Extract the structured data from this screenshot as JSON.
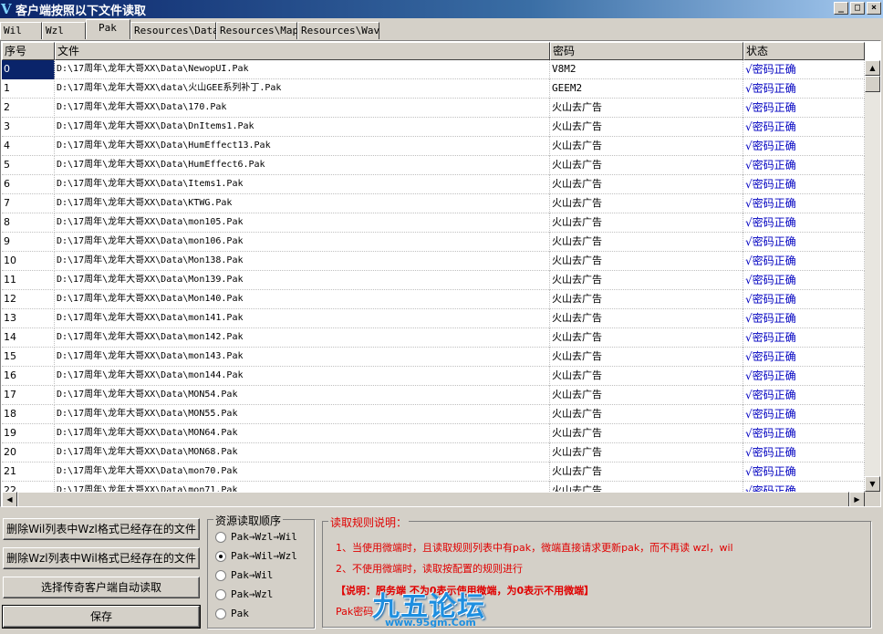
{
  "window": {
    "title": "客户端按照以下文件读取",
    "min_label": "_",
    "max_label": "□",
    "close_label": "×"
  },
  "tabs": [
    {
      "label": "Wil"
    },
    {
      "label": "Wzl"
    },
    {
      "label": "Pak"
    },
    {
      "label": "Resources\\Data"
    },
    {
      "label": "Resources\\Map"
    },
    {
      "label": "Resources\\Wav"
    }
  ],
  "table": {
    "columns": [
      "序号",
      "文件",
      "密码",
      "状态"
    ],
    "rows": [
      {
        "idx": "0",
        "file": "D:\\17周年\\龙年大哥XX\\Data\\NewopUI.Pak",
        "pwd": "V8M2",
        "status": "√密码正确"
      },
      {
        "idx": "1",
        "file": "D:\\17周年\\龙年大哥XX\\data\\火山GEE系列补丁.Pak",
        "pwd": "GEEM2",
        "status": "√密码正确"
      },
      {
        "idx": "2",
        "file": "D:\\17周年\\龙年大哥XX\\Data\\170.Pak",
        "pwd": "火山去广告",
        "status": "√密码正确"
      },
      {
        "idx": "3",
        "file": "D:\\17周年\\龙年大哥XX\\Data\\DnItems1.Pak",
        "pwd": "火山去广告",
        "status": "√密码正确"
      },
      {
        "idx": "4",
        "file": "D:\\17周年\\龙年大哥XX\\Data\\HumEffect13.Pak",
        "pwd": "火山去广告",
        "status": "√密码正确"
      },
      {
        "idx": "5",
        "file": "D:\\17周年\\龙年大哥XX\\Data\\HumEffect6.Pak",
        "pwd": "火山去广告",
        "status": "√密码正确"
      },
      {
        "idx": "6",
        "file": "D:\\17周年\\龙年大哥XX\\Data\\Items1.Pak",
        "pwd": "火山去广告",
        "status": "√密码正确"
      },
      {
        "idx": "7",
        "file": "D:\\17周年\\龙年大哥XX\\Data\\KTWG.Pak",
        "pwd": "火山去广告",
        "status": "√密码正确"
      },
      {
        "idx": "8",
        "file": "D:\\17周年\\龙年大哥XX\\Data\\mon105.Pak",
        "pwd": "火山去广告",
        "status": "√密码正确"
      },
      {
        "idx": "9",
        "file": "D:\\17周年\\龙年大哥XX\\Data\\mon106.Pak",
        "pwd": "火山去广告",
        "status": "√密码正确"
      },
      {
        "idx": "10",
        "file": "D:\\17周年\\龙年大哥XX\\Data\\Mon138.Pak",
        "pwd": "火山去广告",
        "status": "√密码正确"
      },
      {
        "idx": "11",
        "file": "D:\\17周年\\龙年大哥XX\\Data\\Mon139.Pak",
        "pwd": "火山去广告",
        "status": "√密码正确"
      },
      {
        "idx": "12",
        "file": "D:\\17周年\\龙年大哥XX\\Data\\Mon140.Pak",
        "pwd": "火山去广告",
        "status": "√密码正确"
      },
      {
        "idx": "13",
        "file": "D:\\17周年\\龙年大哥XX\\Data\\mon141.Pak",
        "pwd": "火山去广告",
        "status": "√密码正确"
      },
      {
        "idx": "14",
        "file": "D:\\17周年\\龙年大哥XX\\Data\\mon142.Pak",
        "pwd": "火山去广告",
        "status": "√密码正确"
      },
      {
        "idx": "15",
        "file": "D:\\17周年\\龙年大哥XX\\Data\\mon143.Pak",
        "pwd": "火山去广告",
        "status": "√密码正确"
      },
      {
        "idx": "16",
        "file": "D:\\17周年\\龙年大哥XX\\Data\\mon144.Pak",
        "pwd": "火山去广告",
        "status": "√密码正确"
      },
      {
        "idx": "17",
        "file": "D:\\17周年\\龙年大哥XX\\Data\\MON54.Pak",
        "pwd": "火山去广告",
        "status": "√密码正确"
      },
      {
        "idx": "18",
        "file": "D:\\17周年\\龙年大哥XX\\Data\\MON55.Pak",
        "pwd": "火山去广告",
        "status": "√密码正确"
      },
      {
        "idx": "19",
        "file": "D:\\17周年\\龙年大哥XX\\Data\\MON64.Pak",
        "pwd": "火山去广告",
        "status": "√密码正确"
      },
      {
        "idx": "20",
        "file": "D:\\17周年\\龙年大哥XX\\Data\\MON68.Pak",
        "pwd": "火山去广告",
        "status": "√密码正确"
      },
      {
        "idx": "21",
        "file": "D:\\17周年\\龙年大哥XX\\Data\\mon70.Pak",
        "pwd": "火山去广告",
        "status": "√密码正确"
      },
      {
        "idx": "22",
        "file": "D:\\17周年\\龙年大哥XX\\Data\\mon71.Pak",
        "pwd": "火山去广告",
        "status": "√密码正确"
      }
    ]
  },
  "buttons": {
    "delete_wil": "删除Wil列表中Wzl格式已经存在的文件",
    "delete_wzl": "删除Wzl列表中Wil格式已经存在的文件",
    "auto_read": "选择传奇客户端自动读取",
    "save": "保存"
  },
  "order_group": {
    "title": "资源读取顺序",
    "options": [
      {
        "label": "Pak→Wzl→Wil",
        "checked": false
      },
      {
        "label": "Pak→Wil→Wzl",
        "checked": true
      },
      {
        "label": "Pak→Wil",
        "checked": false
      },
      {
        "label": "Pak→Wzl",
        "checked": false
      },
      {
        "label": "Pak",
        "checked": false
      }
    ]
  },
  "rules_group": {
    "title": "读取规则说明：",
    "lines": [
      "1、当使用微端时，且读取规则列表中有pak，微端直接请求更新pak，而不再读 wzl，wil",
      "2、不使用微端时，读取按配置的规则进行",
      "【说明：服务端                 不为0表示使用微端，为0表示不用微端】",
      "Pak密码"
    ]
  },
  "watermark": {
    "logo": "九五论坛",
    "url": "www.95gm.Com"
  },
  "colors": {
    "title_bar": "#0a246a",
    "status_text": "#0000c0",
    "rules_text": "#e00000",
    "selection": "#0a246a"
  }
}
